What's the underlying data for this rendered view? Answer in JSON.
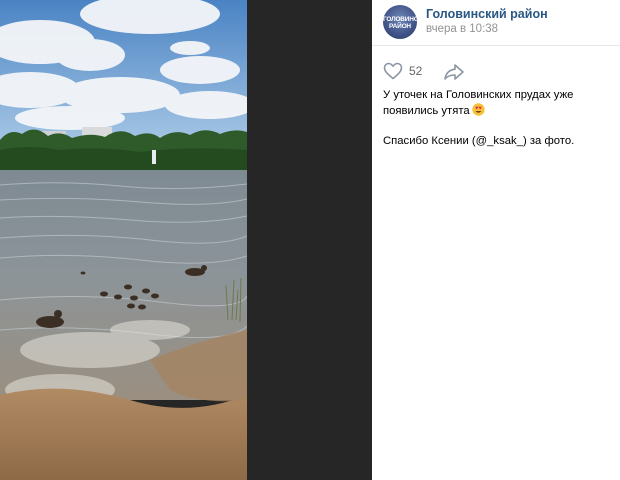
{
  "post": {
    "author": "Головинский район",
    "time": "вчера в 10:38",
    "avatar_text": "ГОЛОВИНСКИЙ РАЙОН",
    "likes": "52",
    "text_line1": "У уточек на Головинских прудах уже появились утята",
    "text_line2": "Спасибо Ксении (@_ksak_) за фото.",
    "emoji_icon": "heart-eyes-emoji-icon"
  },
  "icons": {
    "like": "heart-outline-icon",
    "share": "share-arrow-icon"
  },
  "colors": {
    "link": "#2a5885",
    "muted": "#939393",
    "viewer_background": "#262626"
  }
}
